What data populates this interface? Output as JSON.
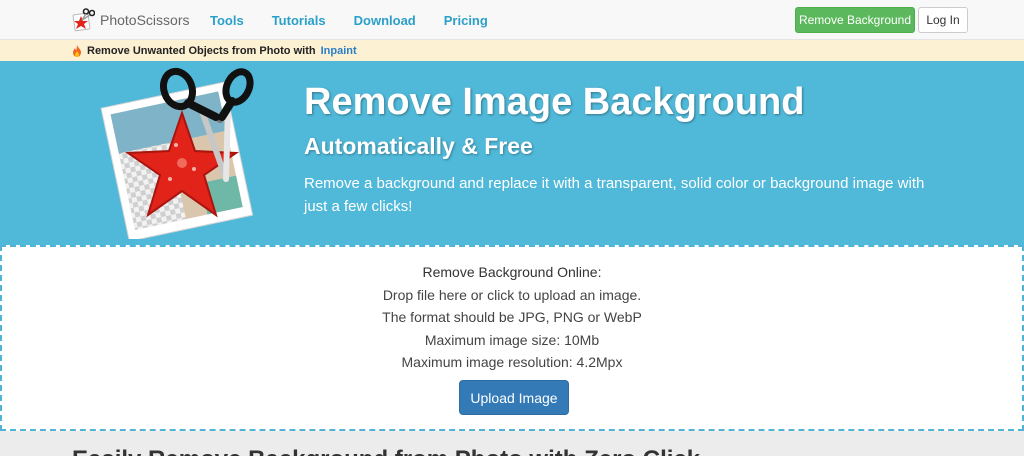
{
  "brand": {
    "name": "PhotoScissors"
  },
  "nav": {
    "items": [
      "Tools",
      "Tutorials",
      "Download",
      "Pricing"
    ]
  },
  "header_buttons": {
    "remove_background": "Remove Background",
    "login": "Log In"
  },
  "promo": {
    "text": "Remove Unwanted Objects from Photo with",
    "link": "Inpaint"
  },
  "hero": {
    "title": "Remove Image Background",
    "subtitle": "Automatically & Free",
    "description": "Remove a background and replace it with a transparent, solid color or background image with just a few clicks!"
  },
  "upload": {
    "heading": "Remove Background Online:",
    "lines": [
      "Drop file here or click to upload an image.",
      "The format should be JPG, PNG or WebP",
      "Maximum image size: 10Mb",
      "Maximum image resolution: 4.2Mpx"
    ],
    "button": "Upload Image"
  },
  "next_section": {
    "heading": "Easily Remove Background from Photo with Zero Click"
  },
  "colors": {
    "hero_bg": "#50b8d8",
    "nav_link": "#2aa0c9",
    "primary_button": "#337ab7",
    "success_button": "#5cb85c",
    "promo_bg": "#fcf1d3",
    "starfish": "#e2231a"
  },
  "icons": {
    "brand_logo": "scissors-star-logo-icon",
    "promo": "flame-icon"
  }
}
